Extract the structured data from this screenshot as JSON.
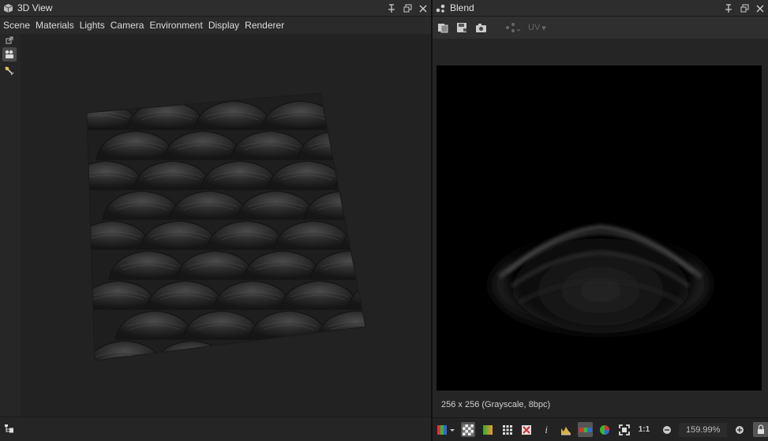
{
  "left_panel": {
    "title": "3D View",
    "menu": [
      "Scene",
      "Materials",
      "Lights",
      "Camera",
      "Environment",
      "Display",
      "Renderer"
    ]
  },
  "right_panel": {
    "title": "Blend",
    "uv_label": "UV",
    "image_info": "256 x 256 (Grayscale, 8bpc)",
    "zoom_level": "159.99%",
    "one_to_one": "1:1",
    "info_glyph": "i"
  }
}
